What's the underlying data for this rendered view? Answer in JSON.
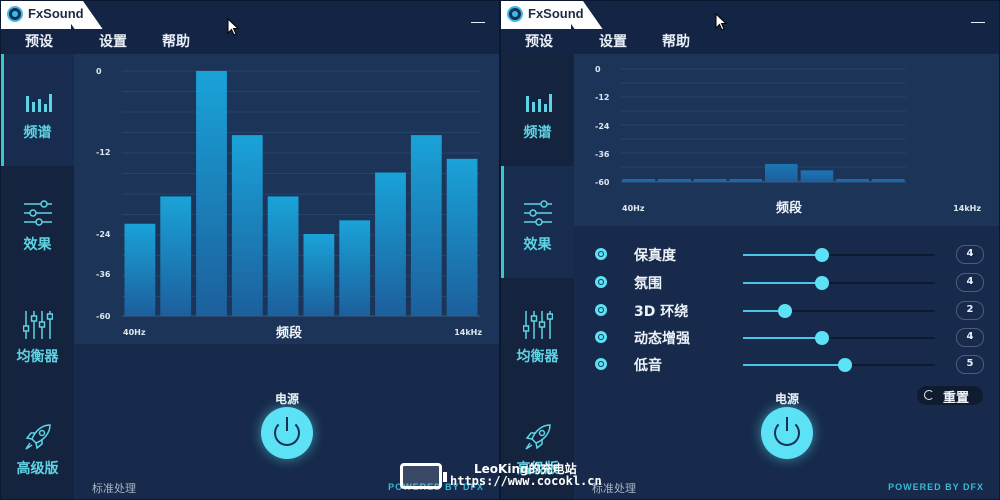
{
  "app": {
    "logo_text": "FxSound"
  },
  "menu": {
    "presets": "预设",
    "settings": "设置",
    "help": "帮助"
  },
  "sidebar": {
    "items": [
      {
        "label": "频谱",
        "icon": "spectrum-icon"
      },
      {
        "label": "效果",
        "icon": "sliders-icon"
      },
      {
        "label": "均衡器",
        "icon": "equalizer-icon"
      },
      {
        "label": "高级版",
        "icon": "rocket-icon"
      }
    ]
  },
  "chart_data": [
    {
      "type": "bar",
      "xlabel": "频段",
      "x_tick_labels": [
        "40Hz",
        "14kHz"
      ],
      "y_tick_labels": [
        "0",
        "-12",
        "-24",
        "-36",
        "-60"
      ],
      "values": [
        -22.5,
        -18.5,
        0,
        -9.5,
        -18.5,
        -24,
        -22,
        -15,
        -9.5,
        -13
      ],
      "color": "#1aa3d8"
    },
    {
      "type": "bar",
      "xlabel": "频段",
      "x_tick_labels": [
        "40Hz",
        "14kHz"
      ],
      "y_tick_labels": [
        "0",
        "-12",
        "-24",
        "-36",
        "-60"
      ],
      "values": [
        -57.5,
        -57.5,
        -57.5,
        -57.5,
        -44.5,
        -50,
        -57.5,
        -57.5
      ],
      "color": "#1d75b4"
    }
  ],
  "effects": [
    {
      "name": "保真度",
      "value": "4",
      "level": 0.41
    },
    {
      "name": "氛围",
      "value": "4",
      "level": 0.41
    },
    {
      "name": "3D 环绕",
      "value": "2",
      "level": 0.22
    },
    {
      "name": "动态增强",
      "value": "4",
      "level": 0.41
    },
    {
      "name": "低音",
      "value": "5",
      "level": 0.53
    }
  ],
  "reset_label": "重置",
  "power": {
    "label": "电源"
  },
  "footer": {
    "mode": "标准处理",
    "powered_by": "POWERED BY DFX"
  },
  "watermark": {
    "line1": "LeoKing的充电站",
    "line2": "https://www.cocokl.cn"
  },
  "colors": {
    "accent": "#5ce1f5",
    "background": "#172a4b",
    "bar": "#1aa3d8"
  }
}
